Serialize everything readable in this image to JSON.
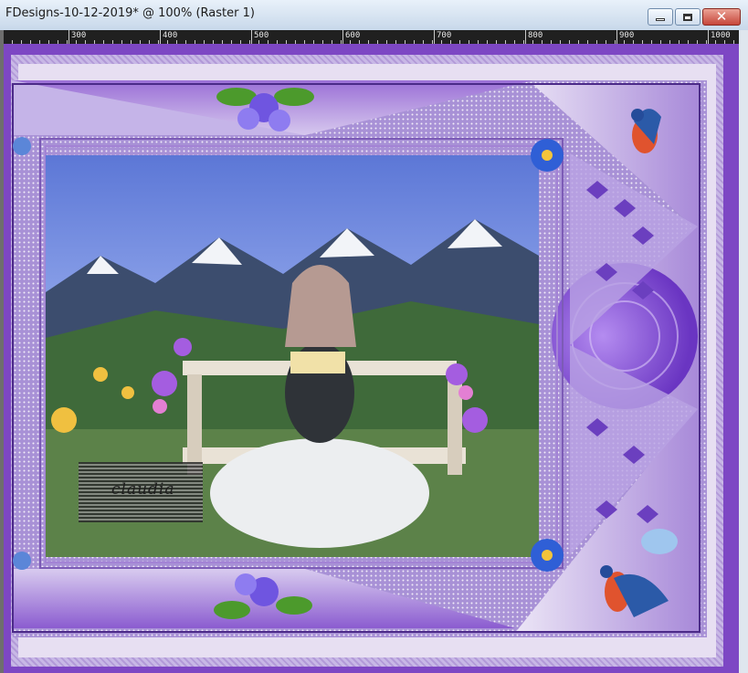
{
  "window": {
    "title": "FDesigns-10-12-2019* @ 100% (Raster 1)",
    "buttons": [
      "minimize",
      "maximize",
      "close"
    ]
  },
  "ruler": {
    "labels": [
      "300",
      "400",
      "500",
      "600",
      "700",
      "800",
      "900",
      "1000"
    ]
  },
  "canvas": {
    "description_colors": {
      "frame": "#7d47c4",
      "accent_light": "#e7dff2",
      "sky": "#5c77d6"
    },
    "watermark": "claudia"
  }
}
